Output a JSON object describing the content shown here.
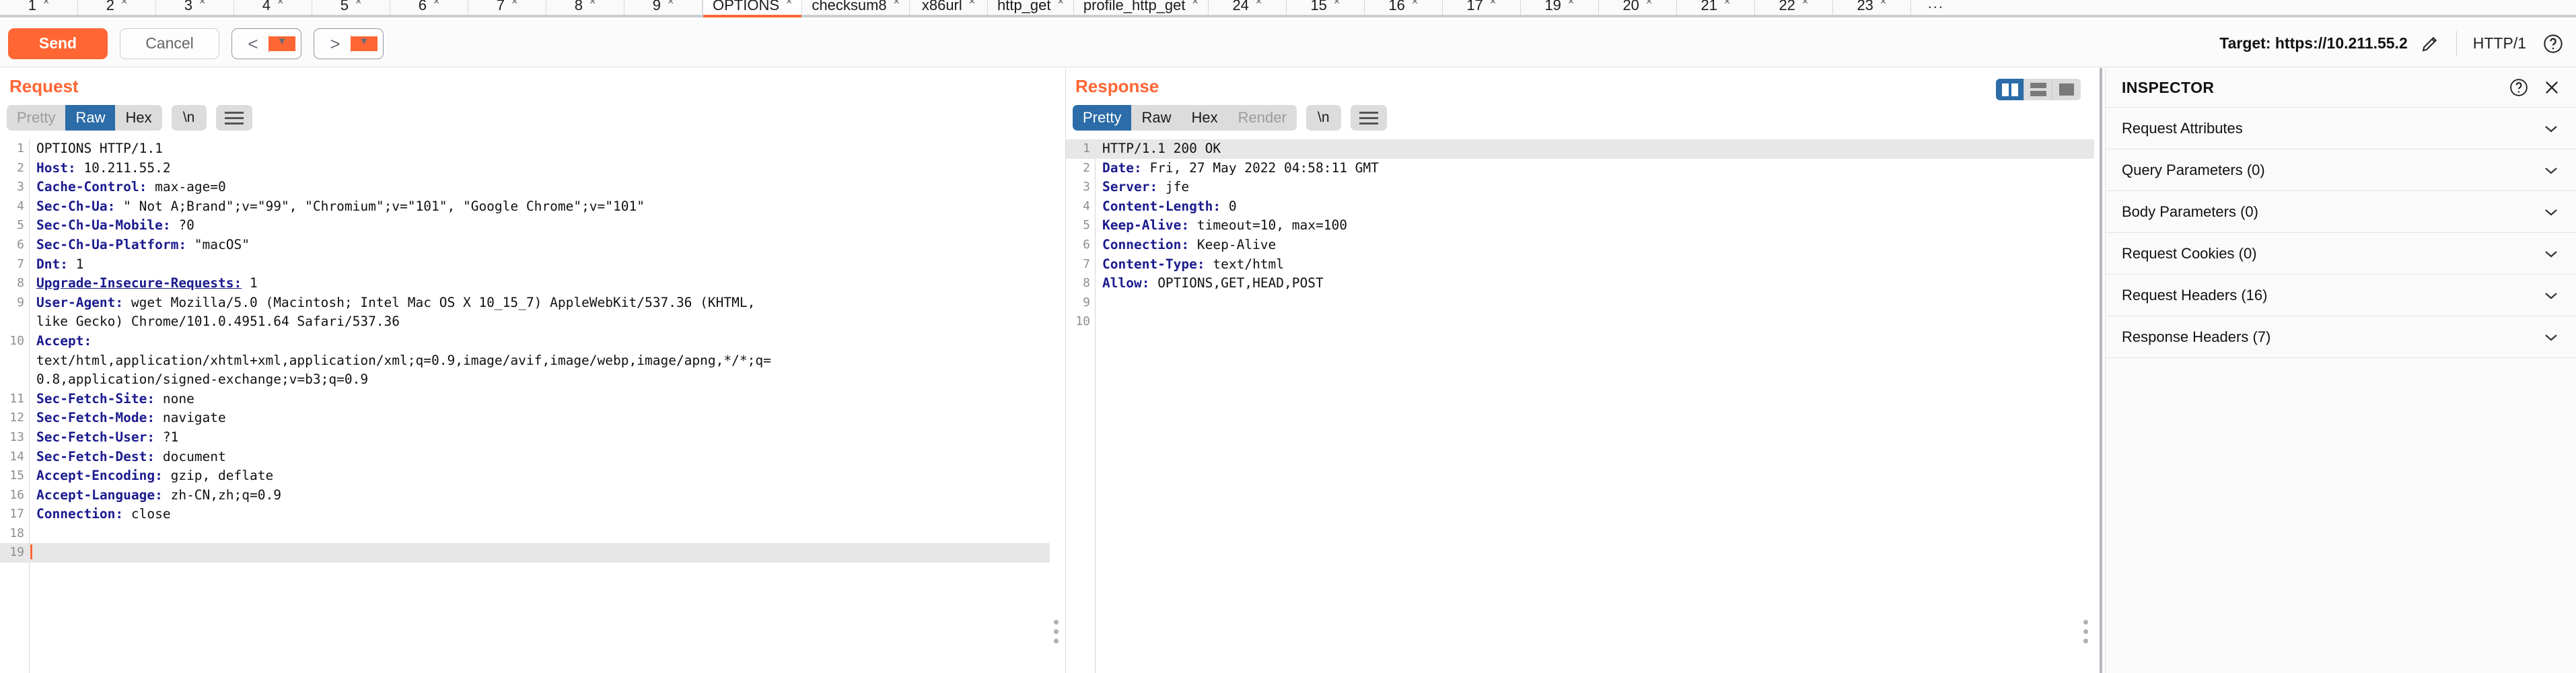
{
  "tabbar": {
    "tabs": [
      {
        "label": "1",
        "active": false
      },
      {
        "label": "2",
        "active": false
      },
      {
        "label": "3",
        "active": false
      },
      {
        "label": "4",
        "active": false
      },
      {
        "label": "5",
        "active": false
      },
      {
        "label": "6",
        "active": false
      },
      {
        "label": "7",
        "active": false
      },
      {
        "label": "8",
        "active": false
      },
      {
        "label": "9",
        "active": false
      },
      {
        "label": "OPTIONS",
        "active": true
      },
      {
        "label": "checksum8",
        "active": false
      },
      {
        "label": "x86url",
        "active": false
      },
      {
        "label": "http_get",
        "active": false
      },
      {
        "label": "profile_http_get",
        "active": false
      },
      {
        "label": "24",
        "active": false
      },
      {
        "label": "15",
        "active": false
      },
      {
        "label": "16",
        "active": false
      },
      {
        "label": "17",
        "active": false
      },
      {
        "label": "19",
        "active": false
      },
      {
        "label": "20",
        "active": false
      },
      {
        "label": "21",
        "active": false
      },
      {
        "label": "22",
        "active": false
      },
      {
        "label": "23",
        "active": false
      }
    ],
    "close_glyph": "×",
    "overflow_label": "..."
  },
  "toolbar": {
    "send_label": "Send",
    "cancel_label": "Cancel",
    "back_arrow": "<",
    "forward_arrow": ">",
    "caret_glyph": "▼",
    "target_label": "Target: https://10.211.55.2",
    "edit_icon": "pencil-icon",
    "http_version": "HTTP/1",
    "help_icon": "question-circle-icon"
  },
  "request": {
    "title": "Request",
    "tabs": [
      {
        "label": "Pretty",
        "state": "dim"
      },
      {
        "label": "Raw",
        "state": "selected"
      },
      {
        "label": "Hex",
        "state": "normal"
      }
    ],
    "newline_label": "\\n",
    "menu_icon": "hamburger-icon",
    "lines": [
      {
        "n": "1",
        "header": "",
        "value": "OPTIONS HTTP/1.1",
        "underline": false
      },
      {
        "n": "2",
        "header": "Host:",
        "value": " 10.211.55.2",
        "underline": false
      },
      {
        "n": "3",
        "header": "Cache-Control:",
        "value": " max-age=0",
        "underline": false
      },
      {
        "n": "4",
        "header": "Sec-Ch-Ua:",
        "value": " \" Not A;Brand\";v=\"99\", \"Chromium\";v=\"101\", \"Google Chrome\";v=\"101\"",
        "underline": false
      },
      {
        "n": "5",
        "header": "Sec-Ch-Ua-Mobile:",
        "value": " ?0",
        "underline": false
      },
      {
        "n": "6",
        "header": "Sec-Ch-Ua-Platform:",
        "value": " \"macOS\"",
        "underline": false
      },
      {
        "n": "7",
        "header": "Dnt:",
        "value": " 1",
        "underline": false
      },
      {
        "n": "8",
        "header": "Upgrade-Insecure-Requests:",
        "value": " 1",
        "underline": true
      },
      {
        "n": "9",
        "header": "User-Agent:",
        "value": " wget Mozilla/5.0 (Macintosh; Intel Mac OS X 10_15_7) AppleWebKit/537.36 (KHTML,",
        "underline": false
      },
      {
        "n": "",
        "header": "",
        "value": "like Gecko) Chrome/101.0.4951.64 Safari/537.36",
        "underline": false
      },
      {
        "n": "10",
        "header": "Accept:",
        "value": "",
        "underline": false
      },
      {
        "n": "",
        "header": "",
        "value": "text/html,application/xhtml+xml,application/xml;q=0.9,image/avif,image/webp,image/apng,*/*;q=",
        "underline": false
      },
      {
        "n": "",
        "header": "",
        "value": "0.8,application/signed-exchange;v=b3;q=0.9",
        "underline": false
      },
      {
        "n": "11",
        "header": "Sec-Fetch-Site:",
        "value": " none",
        "underline": false
      },
      {
        "n": "12",
        "header": "Sec-Fetch-Mode:",
        "value": " navigate",
        "underline": false
      },
      {
        "n": "13",
        "header": "Sec-Fetch-User:",
        "value": " ?1",
        "underline": false
      },
      {
        "n": "14",
        "header": "Sec-Fetch-Dest:",
        "value": " document",
        "underline": false
      },
      {
        "n": "15",
        "header": "Accept-Encoding:",
        "value": " gzip, deflate",
        "underline": false
      },
      {
        "n": "16",
        "header": "Accept-Language:",
        "value": " zh-CN,zh;q=0.9",
        "underline": false
      },
      {
        "n": "17",
        "header": "Connection:",
        "value": " close",
        "underline": false
      },
      {
        "n": "18",
        "header": "",
        "value": "",
        "underline": false
      },
      {
        "n": "19",
        "header": "",
        "value": "",
        "underline": false,
        "cursor": true
      }
    ]
  },
  "response": {
    "title": "Response",
    "tabs": [
      {
        "label": "Pretty",
        "state": "selected"
      },
      {
        "label": "Raw",
        "state": "normal"
      },
      {
        "label": "Hex",
        "state": "normal"
      },
      {
        "label": "Render",
        "state": "dim"
      }
    ],
    "newline_label": "\\n",
    "menu_icon": "hamburger-icon",
    "layout_buttons": [
      {
        "name": "side-by-side-layout",
        "selected": true
      },
      {
        "name": "stacked-layout",
        "selected": false
      },
      {
        "name": "single-pane-layout",
        "selected": false
      }
    ],
    "lines": [
      {
        "n": "1",
        "header": "",
        "value": "HTTP/1.1 200 OK",
        "highlight": true
      },
      {
        "n": "2",
        "header": "Date:",
        "value": " Fri, 27 May 2022 04:58:11 GMT"
      },
      {
        "n": "3",
        "header": "Server:",
        "value": " jfe"
      },
      {
        "n": "4",
        "header": "Content-Length:",
        "value": " 0"
      },
      {
        "n": "5",
        "header": "Keep-Alive:",
        "value": " timeout=10, max=100"
      },
      {
        "n": "6",
        "header": "Connection:",
        "value": " Keep-Alive"
      },
      {
        "n": "7",
        "header": "Content-Type:",
        "value": " text/html"
      },
      {
        "n": "8",
        "header": "Allow:",
        "value": " OPTIONS,GET,HEAD,POST"
      },
      {
        "n": "9",
        "header": "",
        "value": ""
      },
      {
        "n": "10",
        "header": "",
        "value": ""
      }
    ]
  },
  "inspector": {
    "title": "INSPECTOR",
    "help_icon": "question-circle-icon",
    "close_icon": "close-icon",
    "rows": [
      {
        "label": "Request Attributes"
      },
      {
        "label": "Query Parameters (0)"
      },
      {
        "label": "Body Parameters (0)"
      },
      {
        "label": "Request Cookies (0)"
      },
      {
        "label": "Request Headers (16)"
      },
      {
        "label": "Response Headers (7)"
      }
    ],
    "chevron_glyph": "⌄"
  },
  "colors": {
    "accent_orange": "#ff6633",
    "selected_blue": "#2c6ca8",
    "header_blue": "#1b1b8f",
    "highlight_grey": "#e7e7e7"
  }
}
